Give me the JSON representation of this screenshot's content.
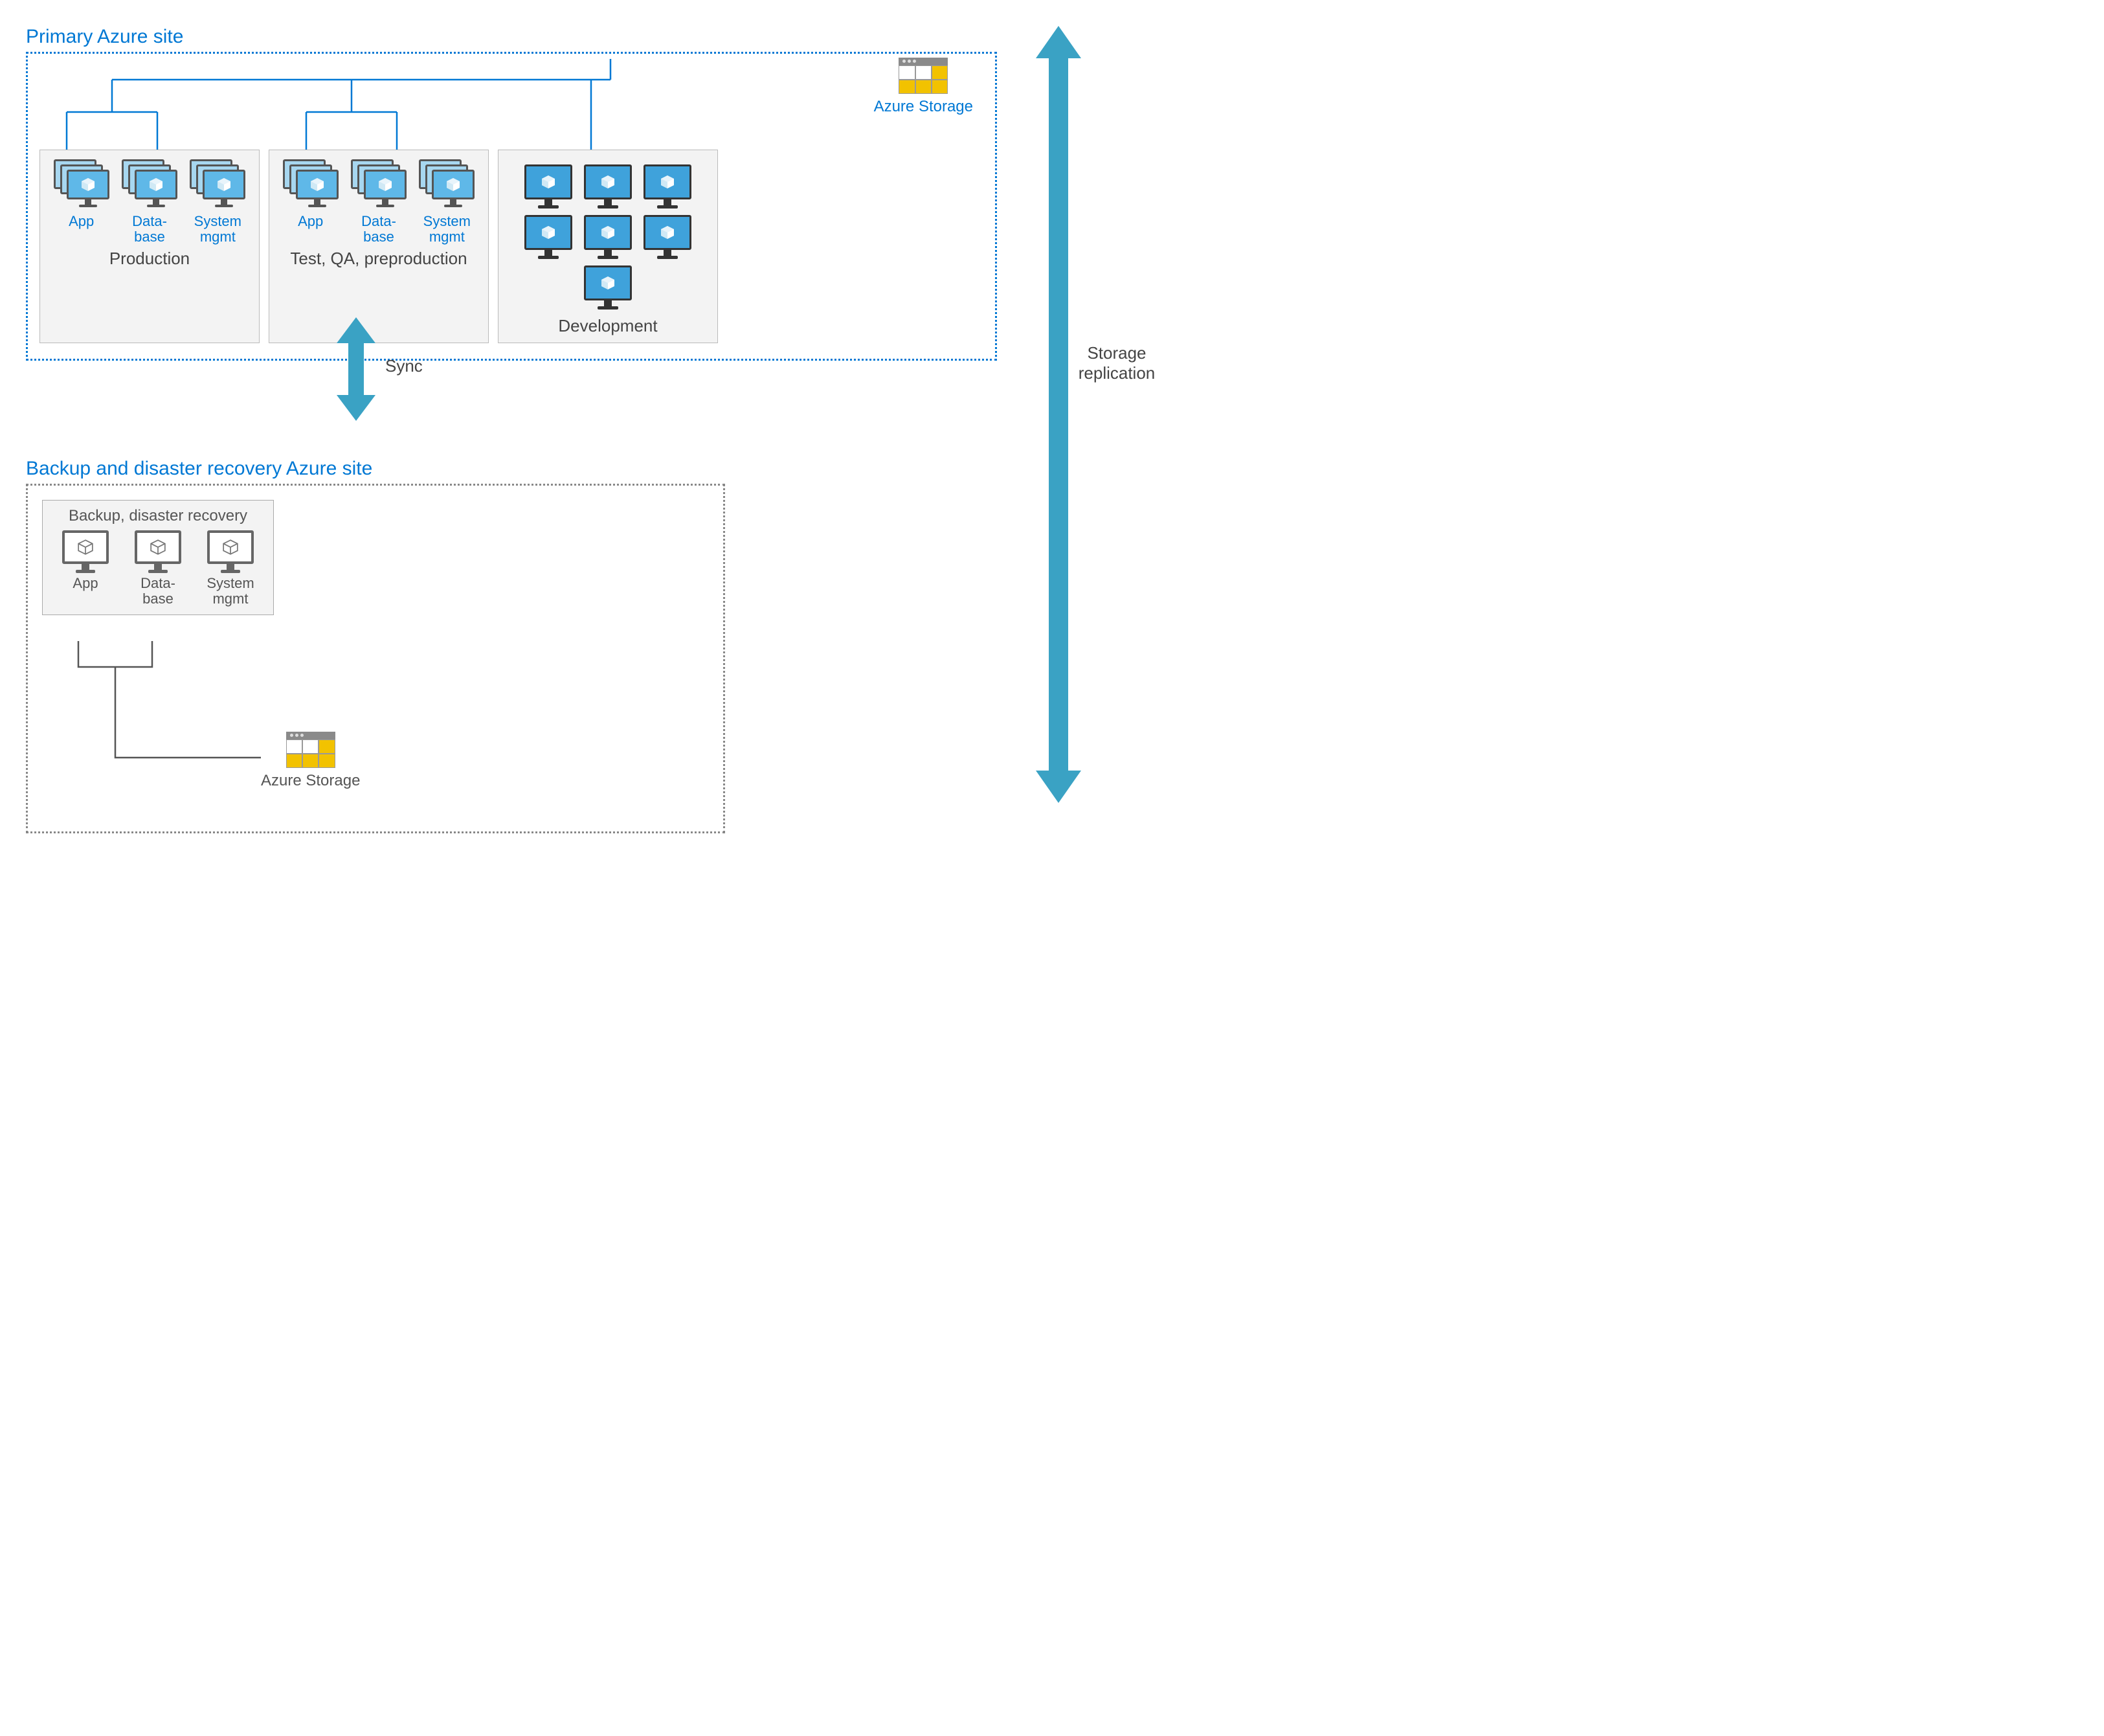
{
  "primary_site": {
    "title": "Primary Azure site",
    "storage_label": "Azure Storage",
    "zones": {
      "production": {
        "label": "Production",
        "tiers": [
          {
            "id": "app",
            "label": "App"
          },
          {
            "id": "database",
            "label": "Data-\nbase"
          },
          {
            "id": "system-mgmt",
            "label": "System\nmgmt"
          }
        ]
      },
      "test": {
        "label": "Test, QA, preproduction",
        "tiers": [
          {
            "id": "app",
            "label": "App"
          },
          {
            "id": "database",
            "label": "Data-\nbase"
          },
          {
            "id": "system-mgmt",
            "label": "System\nmgmt"
          }
        ]
      },
      "development": {
        "label": "Development",
        "vm_count": 7
      }
    }
  },
  "sync_label": "Sync",
  "replication_label": "Storage\nreplication",
  "dr_site": {
    "title": "Backup and disaster recovery Azure site",
    "storage_label": "Azure Storage",
    "zone": {
      "heading": "Backup, disaster recovery",
      "tiers": [
        {
          "id": "app",
          "label": "App"
        },
        {
          "id": "database",
          "label": "Data-\nbase"
        },
        {
          "id": "system-mgmt",
          "label": "System\nmgmt"
        }
      ]
    }
  },
  "colors": {
    "azure_blue": "#0078d4",
    "teal_arrow": "#3aa2c4",
    "gray_border": "#888888"
  }
}
